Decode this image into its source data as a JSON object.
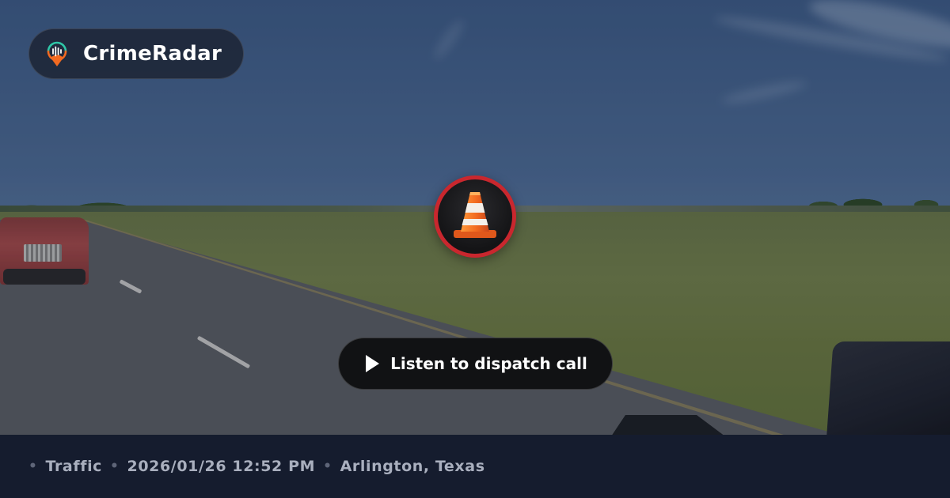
{
  "brand": {
    "name": "CrimeRadar",
    "logo_icon": "radar-pin-icon"
  },
  "incident": {
    "category_icon": "traffic-cone-icon",
    "badge_color": "#c9272e",
    "category": "Traffic",
    "datetime": "2026/01/26 12:52 PM",
    "location": "Arlington, Texas"
  },
  "player": {
    "button_label": "Listen to dispatch call",
    "icon": "play-icon"
  },
  "footer": {
    "separator": "•"
  },
  "colors": {
    "footer_bg": "#151c2e",
    "accent_red": "#c9272e",
    "logo_orange": "#f26a21",
    "logo_teal": "#2fc7a8"
  }
}
